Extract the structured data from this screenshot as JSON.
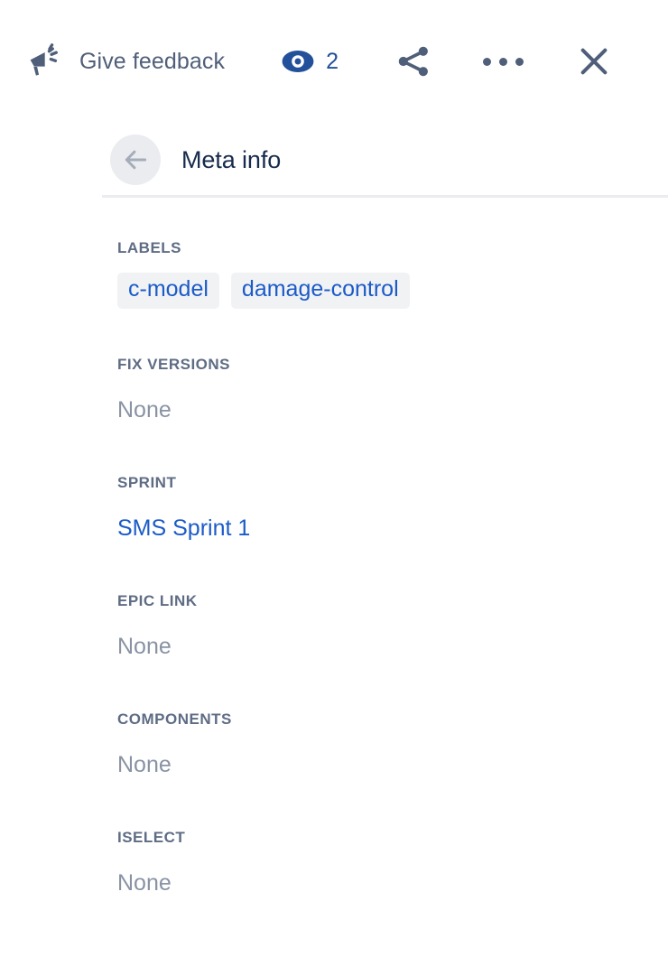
{
  "topbar": {
    "feedback_label": "Give feedback",
    "feedback_icon": "megaphone-icon",
    "watch_icon": "eye-icon",
    "watch_count": "2",
    "share_icon": "share-icon",
    "more_icon": "more-options-icon",
    "close_icon": "close-icon",
    "accent_blue": "#22509B",
    "icon_slate": "#505F79"
  },
  "panel": {
    "back_icon": "arrow-left-icon",
    "title": "Meta info"
  },
  "fields": [
    {
      "label": "LABELS",
      "type": "chips",
      "chips": [
        "c-model",
        "damage-control"
      ]
    },
    {
      "label": "FIX VERSIONS",
      "type": "text",
      "value": "None"
    },
    {
      "label": "SPRINT",
      "type": "link",
      "value": "SMS Sprint 1"
    },
    {
      "label": "EPIC LINK",
      "type": "text",
      "value": "None"
    },
    {
      "label": "COMPONENTS",
      "type": "text",
      "value": "None"
    },
    {
      "label": "ISELECT",
      "type": "text",
      "value": "None"
    }
  ],
  "colors": {
    "link_blue": "#1B5BC8",
    "muted_gray": "#8993A4",
    "label_gray": "#5E6C84",
    "title_navy": "#172B4D",
    "chip_bg": "#F1F2F4",
    "divider": "#EBECF0"
  }
}
